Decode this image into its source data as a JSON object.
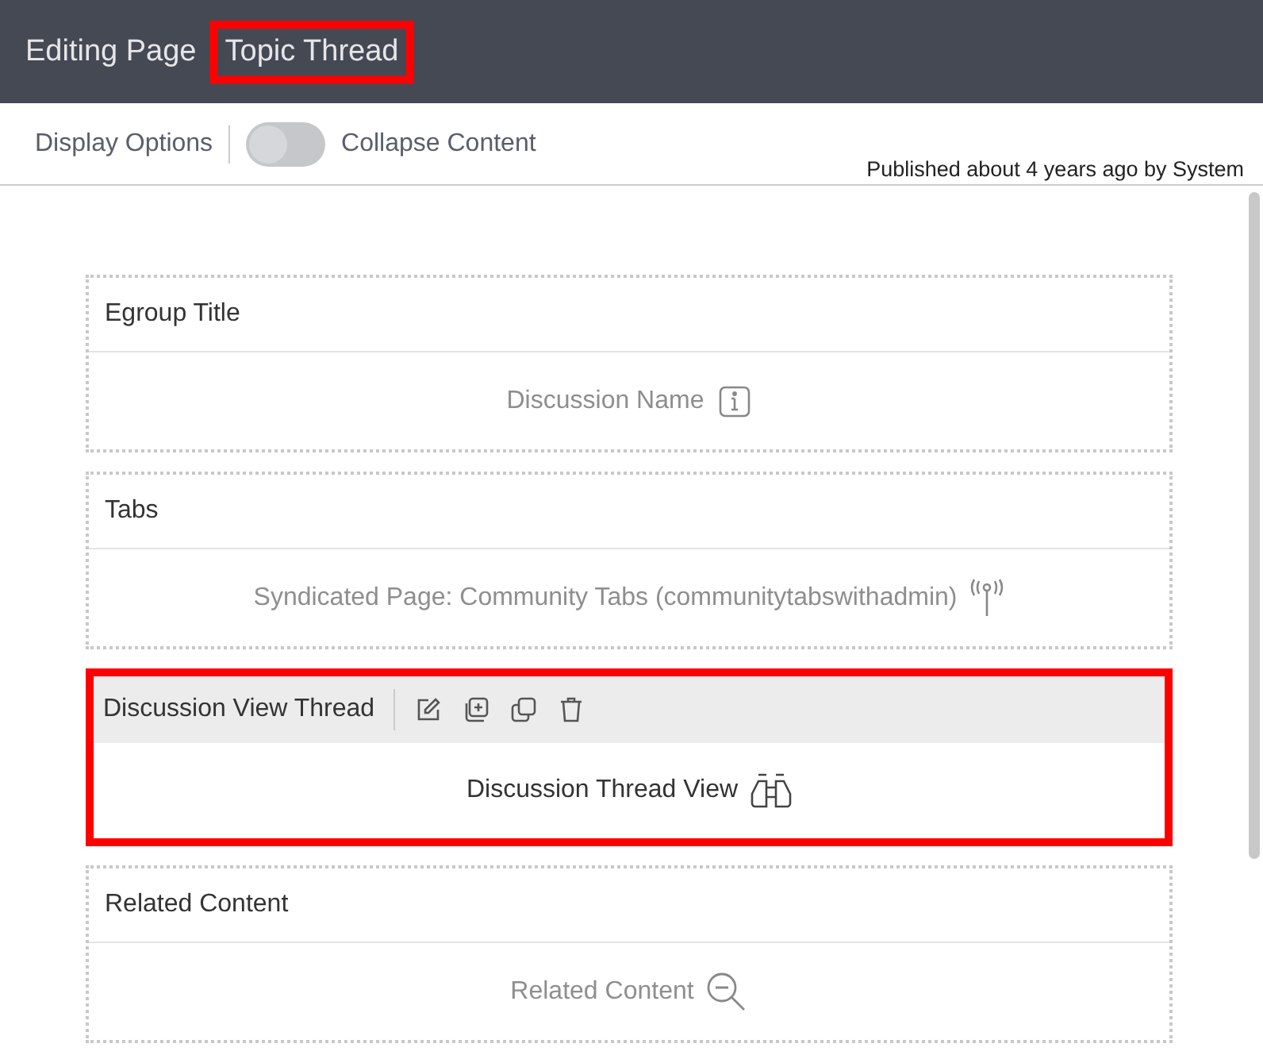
{
  "header": {
    "prefix": "Editing Page",
    "page_name": "Topic Thread",
    "page_name_highlighted": true
  },
  "toolbar": {
    "display_options": "Display Options",
    "collapse_toggle": {
      "label": "Collapse Content",
      "on": false
    },
    "published": "Published about 4 years ago by System"
  },
  "widgets": [
    {
      "title": "Egroup Title",
      "content": "Discussion Name",
      "kind": "info",
      "selected": false,
      "muted": true
    },
    {
      "title": "Tabs",
      "content": "Syndicated Page: Community Tabs (communitytabswithadmin)",
      "kind": "syndicated",
      "selected": false,
      "muted": true
    },
    {
      "title": "Discussion View Thread",
      "content": "Discussion Thread View",
      "kind": "thread",
      "selected": true,
      "muted": false
    },
    {
      "title": "Related Content",
      "content": "Related Content",
      "kind": "related",
      "selected": false,
      "muted": true
    }
  ]
}
